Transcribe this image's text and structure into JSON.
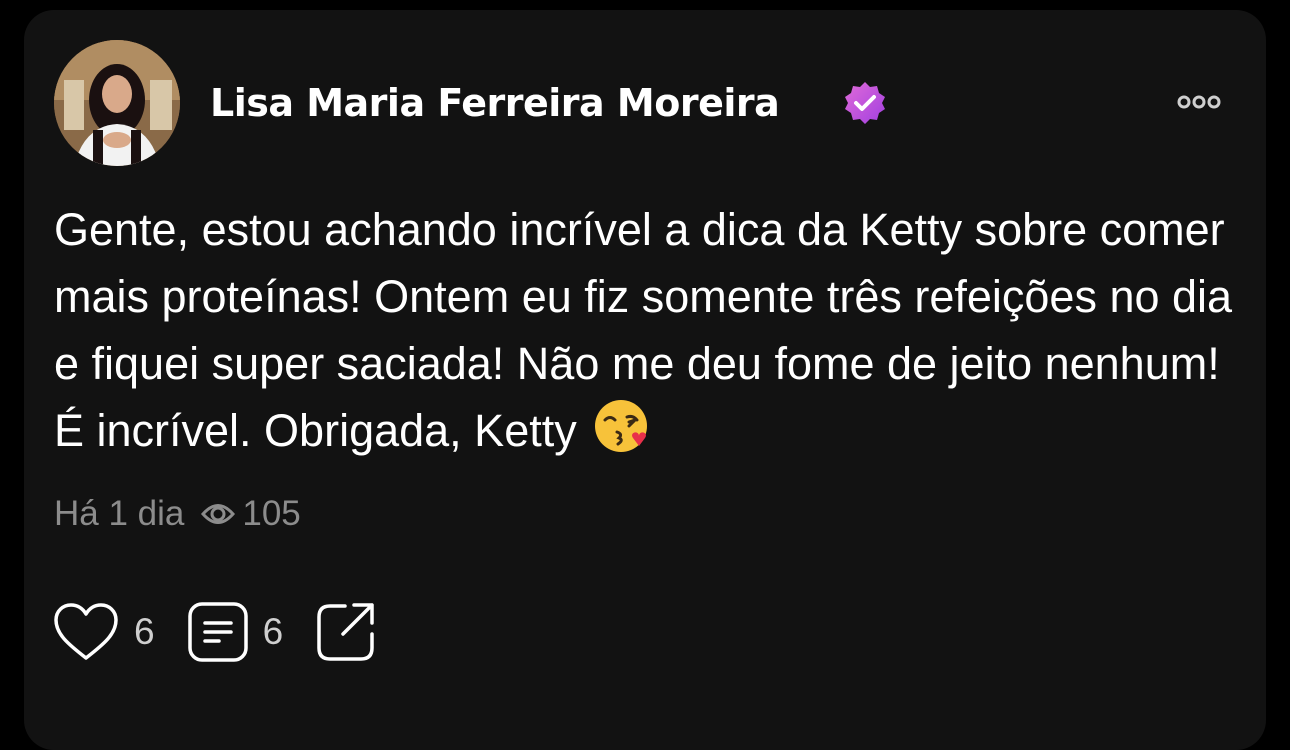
{
  "post": {
    "author_name": "Lisa Maria Ferreira Moreira",
    "verified_icon": "verified-badge-icon",
    "verified_color": "#c04ee0",
    "more_icon": "more-options-icon",
    "text": "Gente, estou achando incrível a dica da Ketty sobre comer mais proteínas! Ontem eu fiz somente três refeições no dia e fiquei super saciada! Não me deu fome de jeito nenhum! É incrível. Obrigada, Ketty",
    "emoji": "face-blowing-a-kiss-emoji",
    "time_ago": "Há 1 dia",
    "views_icon": "eye-icon",
    "views": "105",
    "likes": "6",
    "comments": "6",
    "like_icon": "heart-icon",
    "comment_icon": "comment-icon",
    "share_icon": "share-icon"
  },
  "colors": {
    "background": "#000000",
    "card": "#121212",
    "text_primary": "#ffffff",
    "text_secondary": "#8c8c8c"
  }
}
